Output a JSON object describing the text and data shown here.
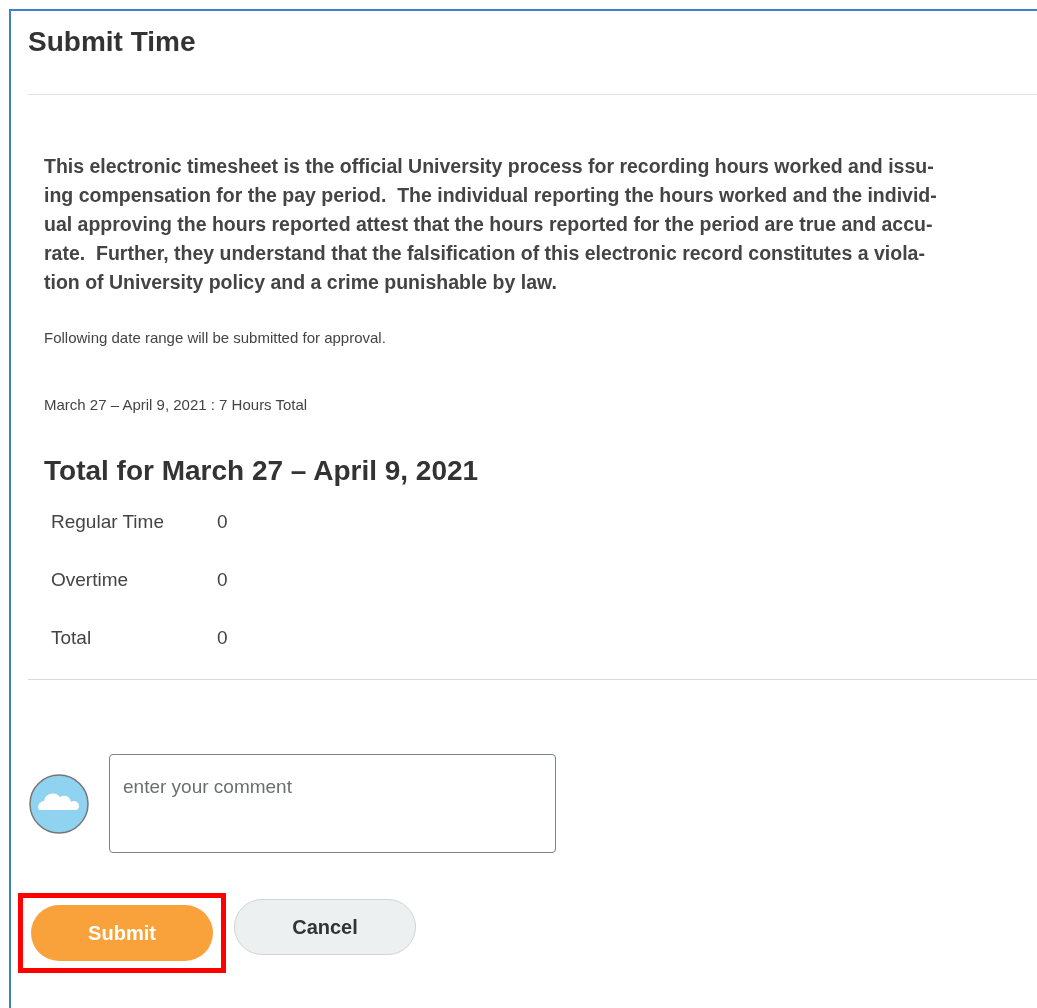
{
  "title": "Submit Time",
  "notice_lines": [
    "This electronic timesheet is the official University process for recording hours worked and issu-",
    "ing compensation for the pay period.  The individual reporting the hours worked and the individ-",
    "ual approving the hours reported attest that the hours reported for the period are true and accu-",
    "rate.  Further, they understand that the falsification of this electronic record constitutes a viola-",
    "tion of University policy and a crime punishable by law."
  ],
  "info": "Following date range will be submitted for approval.",
  "range_summary": "March 27 – April 9, 2021 : 7 Hours Total",
  "totals_heading": "Total for March 27 – April 9, 2021",
  "totals": [
    {
      "label": "Regular Time",
      "value": "0"
    },
    {
      "label": "Overtime",
      "value": "0"
    },
    {
      "label": "Total",
      "value": "0"
    }
  ],
  "comment": {
    "placeholder": "enter your comment"
  },
  "buttons": [
    {
      "label": "Submit",
      "kind": "primary",
      "highlighted": true
    },
    {
      "label": "Cancel",
      "kind": "secondary",
      "highlighted": false
    }
  ]
}
